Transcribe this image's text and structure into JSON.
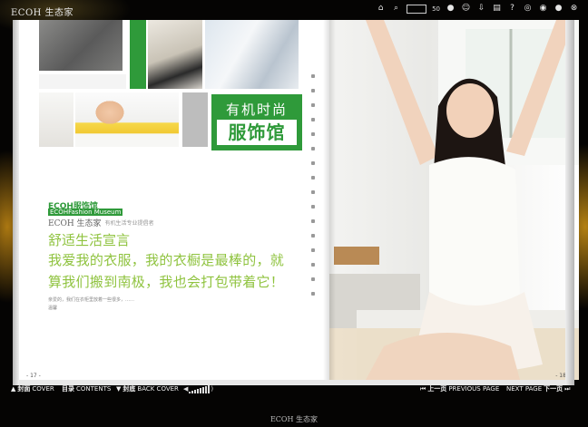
{
  "app": {
    "title": "ECOH 生态家",
    "footer_title": "ECOH 生态家"
  },
  "toolbar": {
    "zoom_value": "50"
  },
  "left_page": {
    "title_line1": "有机时尚",
    "title_line2": "服饰馆",
    "brand_name": "ECOH服饰馆",
    "brand_en": "ECOHFashion Museum",
    "logo_text": "ECOH 生态家",
    "logo_sub": "有机生活专业提倡者",
    "slogan": "舒适生活宣言",
    "copy_line1": "我爱我的衣服，我的衣橱是最棒的，就",
    "copy_line2": "算我们搬到南极，我也会打包带着它！",
    "small_line1": "亲爱的，我们在衣柜里放着一些很多，……",
    "small_line2": "温馨",
    "small_line3": "",
    "page_number": "- 17 -"
  },
  "right_page": {
    "page_number": "- 18 -"
  },
  "bottom_nav": {
    "cover_cn": "封面",
    "cover_en": "COVER",
    "contents_cn": "目录",
    "contents_en": "CONTENTS",
    "back_cn": "封底",
    "back_en": "BACK COVER",
    "prev_cn": "上一页",
    "prev_en": "PREVIOUS PAGE",
    "next_en": "NEXT PAGE",
    "next_cn": "下一页"
  },
  "colors": {
    "brand_green": "#2f9a3a",
    "slogan_green": "#8fc33f"
  }
}
